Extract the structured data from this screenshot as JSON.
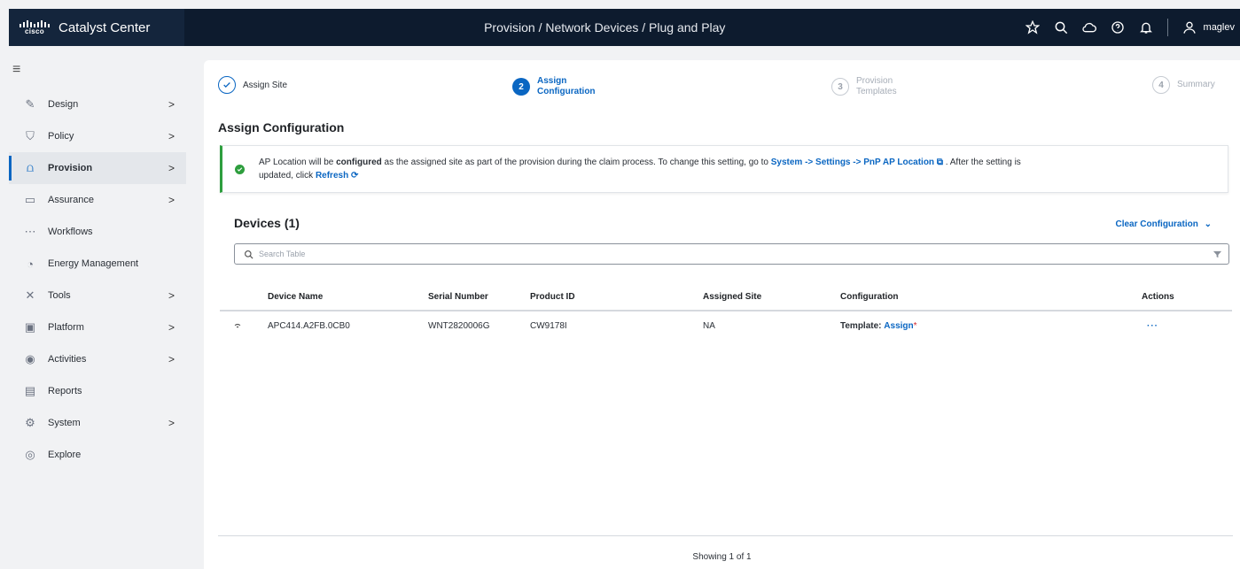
{
  "header": {
    "brand_word": "cisco",
    "app_title": "Catalyst Center",
    "breadcrumb": "Provision / Network Devices / Plug and Play",
    "username": "maglev",
    "icons": [
      "star-icon",
      "search-icon",
      "cloud-icon",
      "help-icon",
      "bell-icon",
      "user-icon"
    ]
  },
  "sidebar": {
    "items": [
      {
        "label": "Design",
        "icon": "design-icon",
        "chevron": ">",
        "active": false
      },
      {
        "label": "Policy",
        "icon": "policy-icon",
        "chevron": ">",
        "active": false
      },
      {
        "label": "Provision",
        "icon": "provision-icon",
        "chevron": ">",
        "active": true
      },
      {
        "label": "Assurance",
        "icon": "assurance-icon",
        "chevron": ">",
        "active": false
      },
      {
        "label": "Workflows",
        "icon": "workflows-icon",
        "chevron": "",
        "active": false
      },
      {
        "label": "Energy Management",
        "icon": "energy-icon",
        "chevron": "",
        "active": false
      },
      {
        "label": "Tools",
        "icon": "tools-icon",
        "chevron": ">",
        "active": false
      },
      {
        "label": "Platform",
        "icon": "platform-icon",
        "chevron": ">",
        "active": false
      },
      {
        "label": "Activities",
        "icon": "activities-icon",
        "chevron": ">",
        "active": false
      },
      {
        "label": "Reports",
        "icon": "reports-icon",
        "chevron": "",
        "active": false
      },
      {
        "label": "System",
        "icon": "system-icon",
        "chevron": ">",
        "active": false
      },
      {
        "label": "Explore",
        "icon": "explore-icon",
        "chevron": "",
        "active": false
      }
    ]
  },
  "stepper": {
    "steps": [
      {
        "number": "",
        "label_1": "Assign Site",
        "label_2": "",
        "state": "done"
      },
      {
        "number": "2",
        "label_1": "Assign",
        "label_2": "Configuration",
        "state": "current"
      },
      {
        "number": "3",
        "label_1": "Provision",
        "label_2": "Templates",
        "state": "future"
      },
      {
        "number": "4",
        "label_1": "Summary",
        "label_2": "",
        "state": "future"
      }
    ]
  },
  "section_title": "Assign Configuration",
  "banner": {
    "text_1": "AP Location will be ",
    "bold_1": "configured",
    "text_2": " as the assigned site as part of the provision during the claim process. To change this setting, go to ",
    "link_1": "System -> Settings -> PnP AP Location",
    "text_3": " . After the setting is",
    "text_4": "updated, click ",
    "link_2": "Refresh"
  },
  "devices": {
    "title": "Devices (1)",
    "clear_config": "Clear Configuration",
    "search_placeholder": "Search Table",
    "columns": {
      "name": "Device Name",
      "serial": "Serial Number",
      "pid": "Product ID",
      "site": "Assigned Site",
      "config": "Configuration",
      "actions": "Actions"
    },
    "rows": [
      {
        "name": "APC414.A2FB.0CB0",
        "serial": "WNT2820006G",
        "pid": "CW9178I",
        "site": "NA",
        "config_label": "Template: ",
        "config_link": "Assign",
        "config_required": "*",
        "actions": "···"
      }
    ],
    "showing": "Showing 1 of 1"
  }
}
